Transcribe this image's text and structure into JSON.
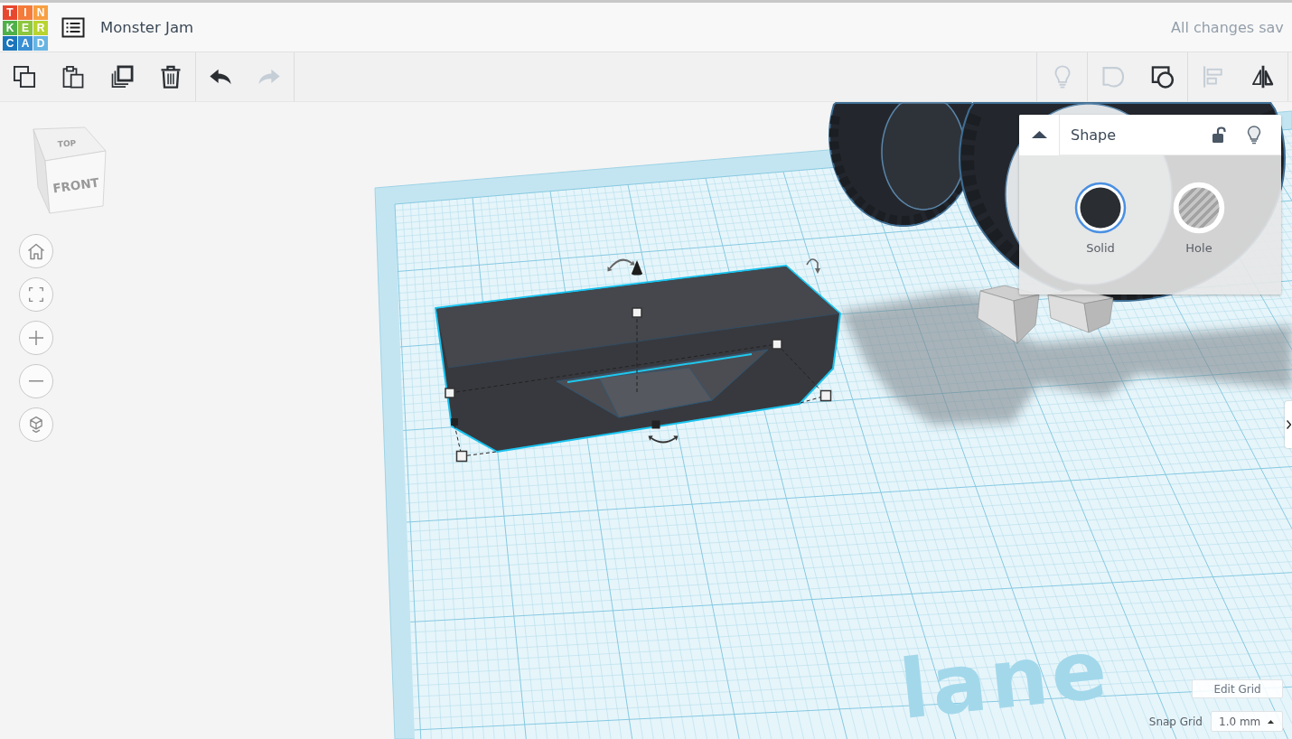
{
  "header": {
    "logo": [
      {
        "letter": "T",
        "color": "#e8472f"
      },
      {
        "letter": "I",
        "color": "#f47b3a"
      },
      {
        "letter": "N",
        "color": "#f7a043"
      },
      {
        "letter": "K",
        "color": "#4fb04a"
      },
      {
        "letter": "E",
        "color": "#8dc63f"
      },
      {
        "letter": "R",
        "color": "#b9d430"
      },
      {
        "letter": "C",
        "color": "#1b75bb"
      },
      {
        "letter": "A",
        "color": "#3a8fd4"
      },
      {
        "letter": "D",
        "color": "#68b5e3"
      }
    ],
    "title": "Monster Jam",
    "save_status": "All changes sav"
  },
  "toolbar": {
    "left_groups": [
      {
        "buttons": [
          {
            "kind": "copy",
            "disabled": false
          },
          {
            "kind": "paste",
            "disabled": false
          },
          {
            "kind": "duplicate",
            "disabled": false
          },
          {
            "kind": "delete",
            "disabled": false
          }
        ]
      },
      {
        "buttons": [
          {
            "kind": "undo",
            "disabled": false
          },
          {
            "kind": "redo",
            "disabled": true
          }
        ]
      }
    ],
    "right_groups": [
      {
        "buttons": [
          {
            "kind": "notes",
            "disabled": true
          }
        ]
      },
      {
        "buttons": [
          {
            "kind": "group",
            "disabled": true
          },
          {
            "kind": "ungroup",
            "disabled": false
          }
        ]
      },
      {
        "buttons": [
          {
            "kind": "align",
            "disabled": true
          },
          {
            "kind": "mirror",
            "disabled": false
          }
        ]
      }
    ]
  },
  "view_cube": {
    "top": "TOP",
    "front": "FRONT"
  },
  "view_controls": [
    {
      "kind": "home"
    },
    {
      "kind": "fit"
    },
    {
      "kind": "zoom_in"
    },
    {
      "kind": "zoom_out"
    },
    {
      "kind": "projection"
    }
  ],
  "workplane": {
    "label": "lane"
  },
  "shape_panel": {
    "title": "Shape",
    "expanded": true,
    "locked": false,
    "options": [
      {
        "kind": "solid",
        "label": "Solid",
        "selected": true
      },
      {
        "kind": "hole",
        "label": "Hole",
        "selected": false
      }
    ]
  },
  "grid_controls": {
    "edit_button": "Edit Grid",
    "snap_label": "Snap Grid",
    "snap_value": "1.0 mm"
  }
}
